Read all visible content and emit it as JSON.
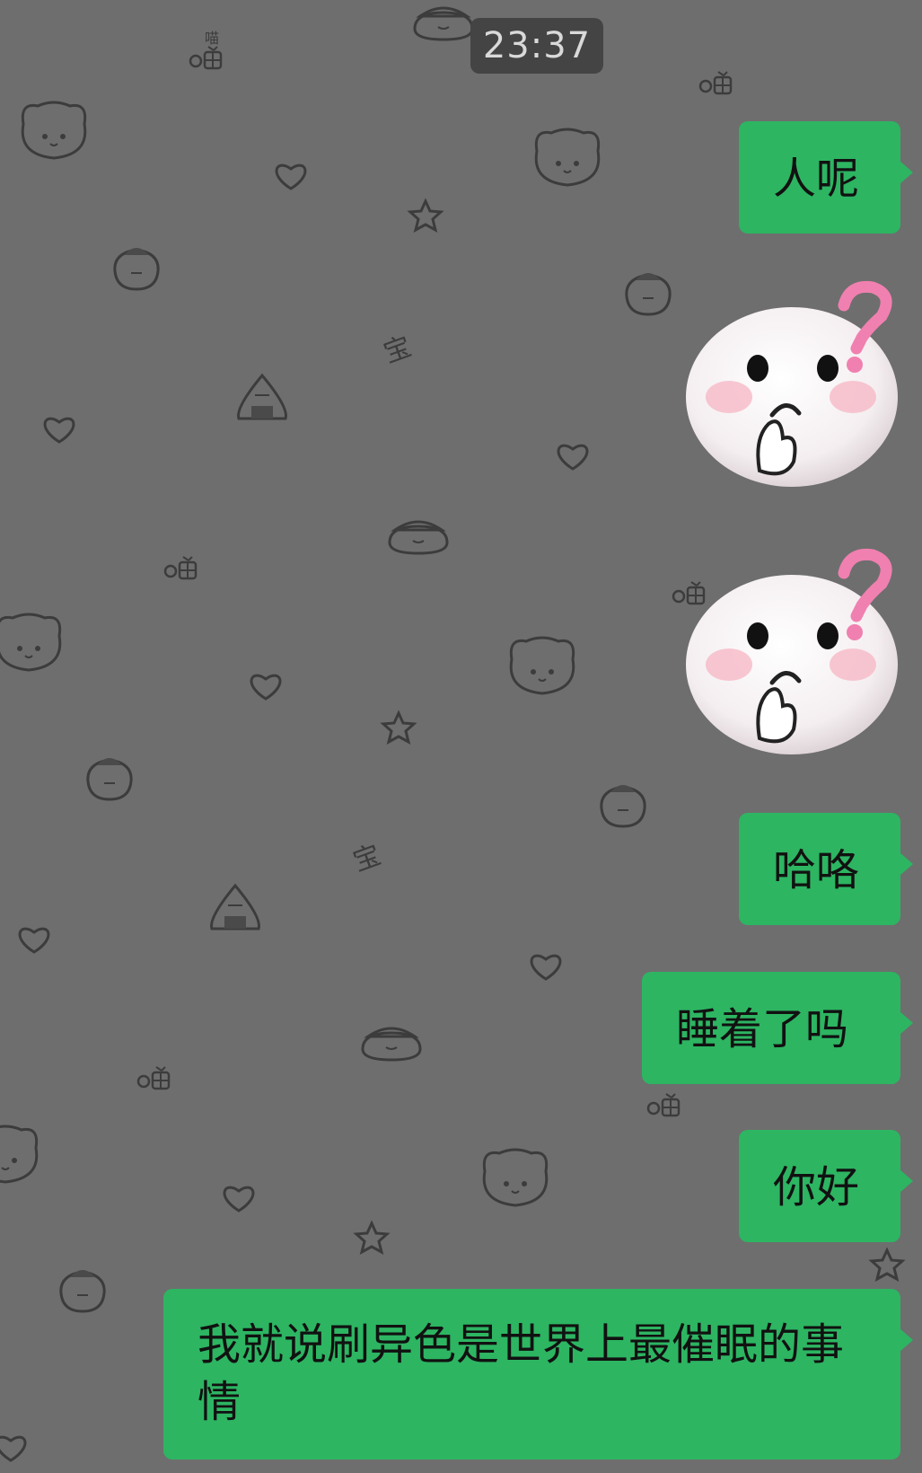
{
  "chat": {
    "timestamp": "23:37",
    "messages": [
      {
        "type": "text",
        "text": "人呢"
      },
      {
        "type": "sticker",
        "sticker": "thinking-face-question-mark"
      },
      {
        "type": "sticker",
        "sticker": "thinking-face-question-mark"
      },
      {
        "type": "text",
        "text": "哈咯"
      },
      {
        "type": "text",
        "text": "睡着了吗"
      },
      {
        "type": "text",
        "text": "你好"
      },
      {
        "type": "text",
        "text": "我就说刷异色是世界上最催眠的事情"
      }
    ]
  },
  "background": {
    "doodles": [
      "bear-face-icon",
      "heart-icon",
      "star-icon",
      "onigiri-icon",
      "fish-cake-icon",
      "cat-meow-icon"
    ],
    "doodle_text": [
      "喵",
      "宝"
    ]
  },
  "colors": {
    "background": "#6e6e6e",
    "bubble": "#2db562",
    "timestamp_bg": "#444444"
  }
}
